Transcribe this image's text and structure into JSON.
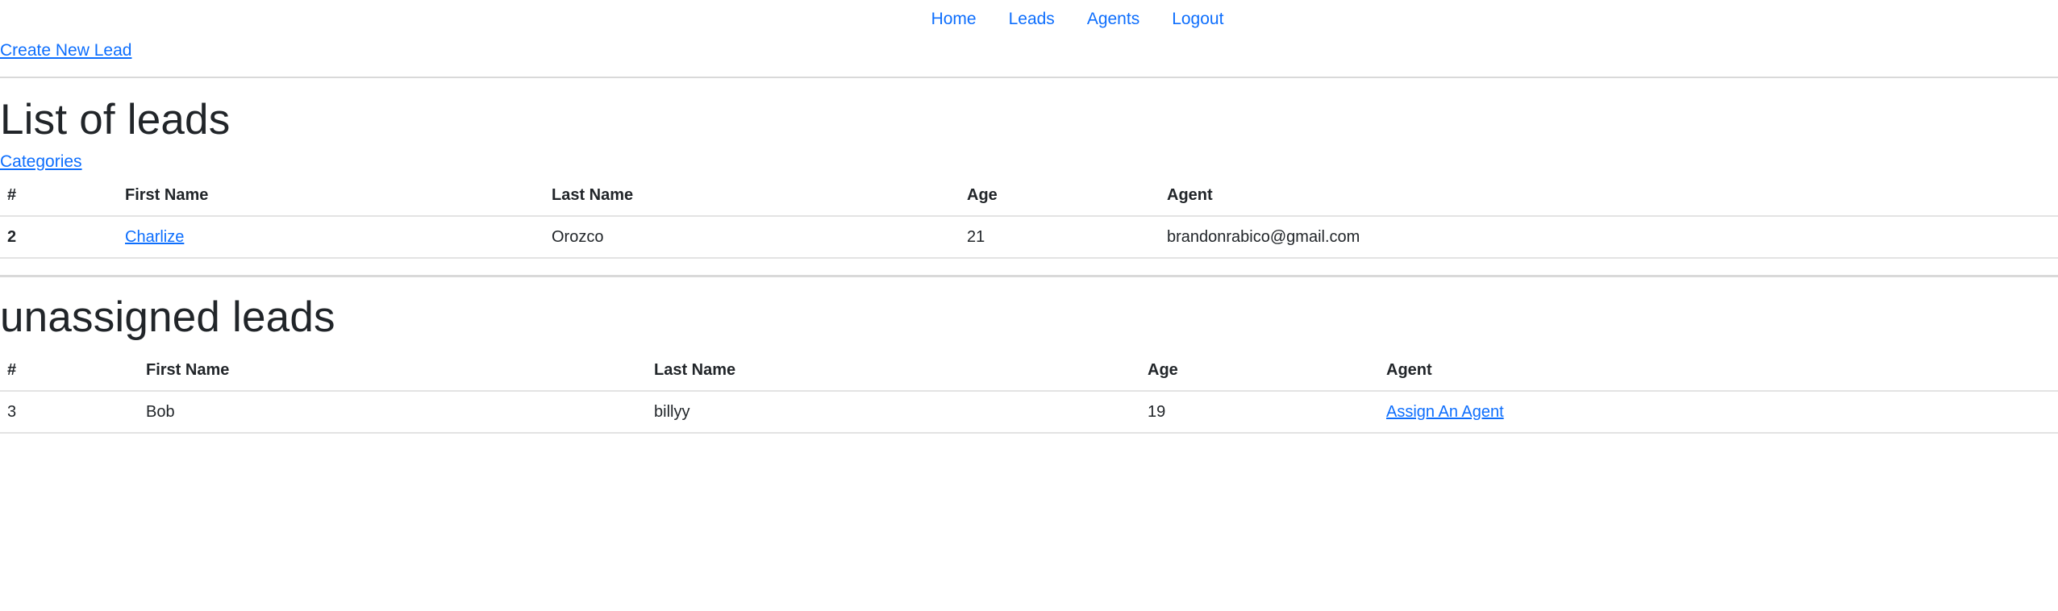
{
  "nav": {
    "items": [
      {
        "label": "Home"
      },
      {
        "label": "Leads"
      },
      {
        "label": "Agents"
      },
      {
        "label": "Logout"
      }
    ]
  },
  "create_link": "Create New Lead",
  "leads_section": {
    "title": "List of leads",
    "categories_link": "Categories",
    "headers": [
      "#",
      "First Name",
      "Last Name",
      "Age",
      "Agent"
    ],
    "rows": [
      {
        "id": "2",
        "first_name": "Charlize",
        "last_name": "Orozco",
        "age": "21",
        "agent": "brandonrabico@gmail.com"
      }
    ]
  },
  "unassigned_section": {
    "title": "unassigned leads",
    "headers": [
      "#",
      "First Name",
      "Last Name",
      "Age",
      "Agent"
    ],
    "rows": [
      {
        "id": "3",
        "first_name": "Bob",
        "last_name": "billyy",
        "age": "19",
        "agent_link": "Assign An Agent"
      }
    ]
  }
}
